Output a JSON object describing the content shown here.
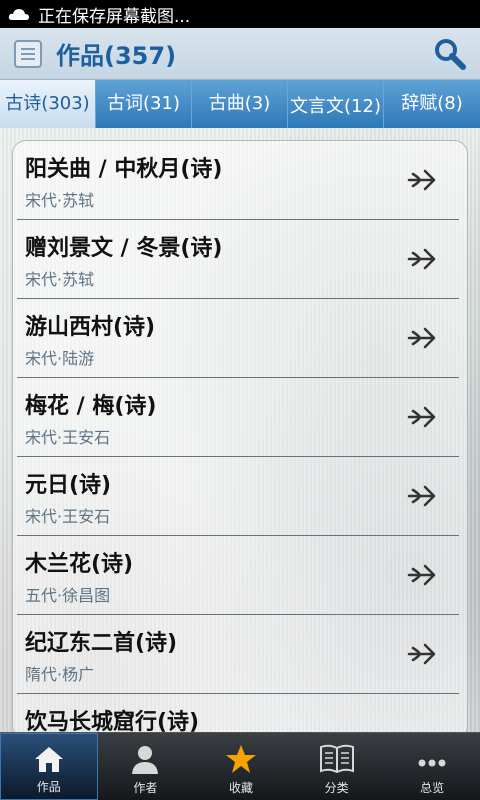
{
  "statusbar": {
    "text": "正在保存屏幕截图..."
  },
  "header": {
    "title": "作品(357)"
  },
  "tabs": [
    {
      "label": "古诗(303)",
      "active": true
    },
    {
      "label": "古词(31)",
      "active": false
    },
    {
      "label": "古曲(3)",
      "active": false
    },
    {
      "label": "文言文(12)",
      "active": false
    },
    {
      "label": "辞赋(8)",
      "active": false
    }
  ],
  "items": [
    {
      "title": "阳关曲 / 中秋月(诗)",
      "subtitle": "宋代·苏轼"
    },
    {
      "title": "赠刘景文 / 冬景(诗)",
      "subtitle": "宋代·苏轼"
    },
    {
      "title": "游山西村(诗)",
      "subtitle": "宋代·陆游"
    },
    {
      "title": "梅花 / 梅(诗)",
      "subtitle": "宋代·王安石"
    },
    {
      "title": "元日(诗)",
      "subtitle": "宋代·王安石"
    },
    {
      "title": "木兰花(诗)",
      "subtitle": "五代·徐昌图"
    },
    {
      "title": "纪辽东二首(诗)",
      "subtitle": "隋代·杨广"
    },
    {
      "title": "饮马长城窟行(诗)",
      "subtitle": ""
    }
  ],
  "bottomnav": [
    {
      "label": "作品",
      "icon": "home-icon",
      "active": true
    },
    {
      "label": "作者",
      "icon": "person-icon",
      "active": false
    },
    {
      "label": "收藏",
      "icon": "star-icon",
      "active": false
    },
    {
      "label": "分类",
      "icon": "book-icon",
      "active": false
    },
    {
      "label": "总览",
      "icon": "more-icon",
      "active": false
    }
  ],
  "colors": {
    "accent": "#1e5f9e",
    "tab_bg": "#2e78b8",
    "star": "#f5a300"
  }
}
